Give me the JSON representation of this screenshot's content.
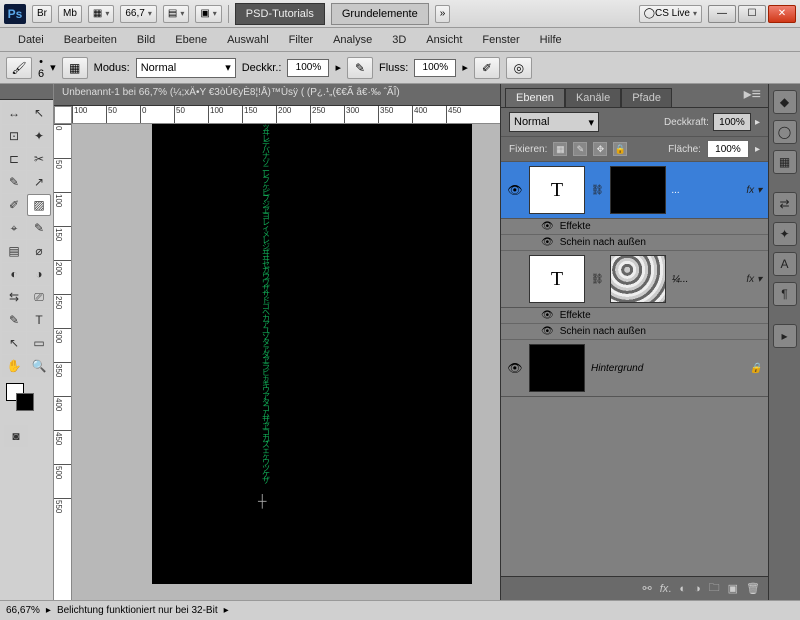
{
  "titlebar": {
    "zoom": "66,7",
    "tabs": [
      {
        "label": "PSD-Tutorials",
        "active": true
      },
      {
        "label": "Grundelemente",
        "active": false
      }
    ],
    "cslive": "CS Live"
  },
  "br_label": "Br",
  "mb_label": "Mb",
  "menubar": [
    "Datei",
    "Bearbeiten",
    "Bild",
    "Ebene",
    "Auswahl",
    "Filter",
    "Analyse",
    "3D",
    "Ansicht",
    "Fenster",
    "Hilfe"
  ],
  "optbar": {
    "brush_size": "6",
    "modus_label": "Modus:",
    "modus_value": "Normal",
    "deckkr_label": "Deckkr.:",
    "deckkr_value": "100%",
    "fluss_label": "Fluss:",
    "fluss_value": "100%"
  },
  "document": {
    "tab_title": "Unbenannt-1 bei 66,7% (¼;xÄ•Y €3òÚ€yÈ8¦!Å)™Ùsÿ      (  (P¿.¹„(€€Ã â€·‰ ˆÃÏ̂)",
    "ruler_h": [
      "100",
      "50",
      "0",
      "50",
      "100",
      "150",
      "200",
      "250",
      "300",
      "350",
      "400",
      "450"
    ],
    "ruler_v": [
      "0",
      "50",
      "100",
      "150",
      "200",
      "250",
      "300",
      "350",
      "400",
      "450",
      "500",
      "550"
    ]
  },
  "statusbar": {
    "zoom": "66,67%",
    "msg": "Belichtung funktioniert nur bei 32-Bit"
  },
  "panels": {
    "tabs": [
      "Ebenen",
      "Kanäle",
      "Pfade"
    ],
    "blend": "Normal",
    "opacity_label": "Deckkraft:",
    "opacity": "100%",
    "lock_label": "Fixieren:",
    "fill_label": "Fläche:",
    "fill": "100%",
    "layers": [
      {
        "type": "text",
        "mask": "black",
        "name": "...",
        "selected": true,
        "effects": [
          "Effekte",
          "Schein nach außen"
        ],
        "visible": true
      },
      {
        "type": "text",
        "mask": "noise",
        "name": "¼...",
        "selected": false,
        "effects": [
          "Effekte",
          "Schein nach außen"
        ],
        "visible": false
      },
      {
        "type": "bg",
        "name": "Hintergrund",
        "locked": true,
        "visible": true
      }
    ]
  },
  "tools": [
    "↔",
    "↖",
    "⊡",
    "✦",
    "⊏",
    "✂",
    "✎",
    "↗",
    "✐",
    "▨",
    "⌖",
    "✎",
    "▤",
    "⌀",
    "◐",
    "◑",
    "⇆",
    "⎚",
    "✎",
    "T",
    "↖",
    "▭",
    "✋",
    "🔍"
  ]
}
